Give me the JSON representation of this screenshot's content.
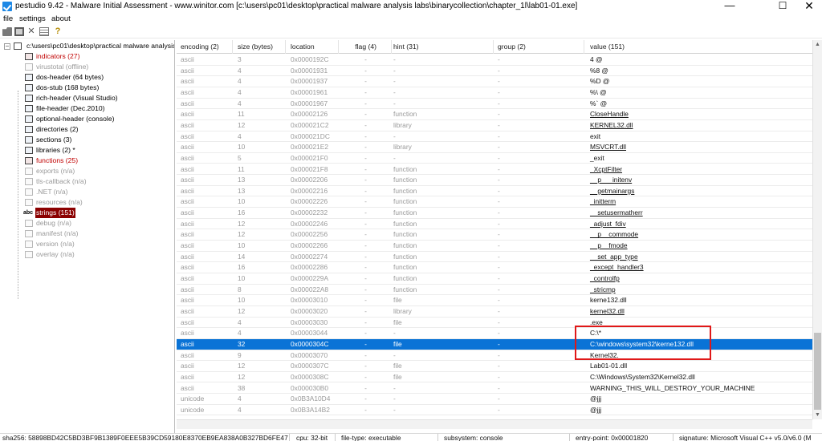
{
  "window": {
    "title": "pestudio 9.42 - Malware Initial Assessment - www.winitor.com [c:\\users\\pc01\\desktop\\practical malware analysis labs\\binarycollection\\chapter_1l\\lab01-01.exe]",
    "minimize": "—",
    "maximize": "☐",
    "close": "✕"
  },
  "menu": {
    "file": "file",
    "settings": "settings",
    "about": "about"
  },
  "tree": {
    "root": "c:\\users\\pc01\\desktop\\practical malware analysis",
    "items": [
      {
        "label": "indicators (27)",
        "color": "red",
        "icon": "indicators-icon"
      },
      {
        "label": "virustotal (offline)",
        "color": "gray",
        "icon": "virustotal-icon"
      },
      {
        "label": "dos-header (64 bytes)",
        "color": "black",
        "icon": "dos-header-icon"
      },
      {
        "label": "dos-stub (168 bytes)",
        "color": "black",
        "icon": "dos-stub-icon"
      },
      {
        "label": "rich-header (Visual Studio)",
        "color": "black",
        "icon": "rich-header-icon"
      },
      {
        "label": "file-header (Dec.2010)",
        "color": "black",
        "icon": "file-header-icon"
      },
      {
        "label": "optional-header (console)",
        "color": "black",
        "icon": "optional-header-icon"
      },
      {
        "label": "directories (2)",
        "color": "black",
        "icon": "directories-icon"
      },
      {
        "label": "sections (3)",
        "color": "black",
        "icon": "sections-icon"
      },
      {
        "label": "libraries (2) *",
        "color": "black",
        "icon": "libraries-icon"
      },
      {
        "label": "functions (25)",
        "color": "red",
        "icon": "functions-icon"
      },
      {
        "label": "exports (n/a)",
        "color": "gray",
        "icon": "exports-icon"
      },
      {
        "label": "tls-callback (n/a)",
        "color": "gray",
        "icon": "tls-callback-icon"
      },
      {
        "label": ".NET (n/a)",
        "color": "gray",
        "icon": "dotnet-icon"
      },
      {
        "label": "resources (n/a)",
        "color": "gray",
        "icon": "resources-icon"
      },
      {
        "label": "strings (151)",
        "color": "selected",
        "icon": "strings-icon",
        "icon_text": "abc"
      },
      {
        "label": "debug (n/a)",
        "color": "gray",
        "icon": "debug-icon"
      },
      {
        "label": "manifest (n/a)",
        "color": "gray",
        "icon": "manifest-icon"
      },
      {
        "label": "version (n/a)",
        "color": "gray",
        "icon": "version-icon"
      },
      {
        "label": "overlay (n/a)",
        "color": "gray",
        "icon": "overlay-icon"
      }
    ]
  },
  "columns": [
    "encoding (2)",
    "size (bytes)",
    "location",
    "flag (4)",
    "hint (31)",
    "group (2)",
    "value (151)"
  ],
  "rows": [
    [
      "ascii",
      "3",
      "0x0000192C",
      "-",
      "-",
      "-",
      "4 @",
      false
    ],
    [
      "ascii",
      "4",
      "0x00001931",
      "-",
      "-",
      "-",
      "%8 @",
      false
    ],
    [
      "ascii",
      "4",
      "0x00001937",
      "-",
      "-",
      "-",
      "%D @",
      false
    ],
    [
      "ascii",
      "4",
      "0x00001961",
      "-",
      "-",
      "-",
      "%\\ @",
      false
    ],
    [
      "ascii",
      "4",
      "0x00001967",
      "-",
      "-",
      "-",
      "%` @",
      false
    ],
    [
      "ascii",
      "11",
      "0x00002126",
      "-",
      "function",
      "-",
      "CloseHandle",
      true
    ],
    [
      "ascii",
      "12",
      "0x000021C2",
      "-",
      "library",
      "-",
      "KERNEL32.dll",
      true
    ],
    [
      "ascii",
      "4",
      "0x000021DC",
      "-",
      "-",
      "-",
      "exit",
      false
    ],
    [
      "ascii",
      "10",
      "0x000021E2",
      "-",
      "library",
      "-",
      "MSVCRT.dll",
      true
    ],
    [
      "ascii",
      "5",
      "0x000021F0",
      "-",
      "-",
      "-",
      "_exit",
      false
    ],
    [
      "ascii",
      "11",
      "0x000021F8",
      "-",
      "function",
      "-",
      "_XcptFilter",
      true
    ],
    [
      "ascii",
      "13",
      "0x00002206",
      "-",
      "function",
      "-",
      "__p___initenv",
      true
    ],
    [
      "ascii",
      "13",
      "0x00002216",
      "-",
      "function",
      "-",
      "__getmainargs",
      true
    ],
    [
      "ascii",
      "10",
      "0x00002226",
      "-",
      "function",
      "-",
      "_initterm",
      true
    ],
    [
      "ascii",
      "16",
      "0x00002232",
      "-",
      "function",
      "-",
      "__setusermatherr",
      true
    ],
    [
      "ascii",
      "12",
      "0x00002246",
      "-",
      "function",
      "-",
      "_adjust_fdiv",
      true
    ],
    [
      "ascii",
      "12",
      "0x00002256",
      "-",
      "function",
      "-",
      "__p__commode",
      true
    ],
    [
      "ascii",
      "10",
      "0x00002266",
      "-",
      "function",
      "-",
      "__p__fmode",
      true
    ],
    [
      "ascii",
      "14",
      "0x00002274",
      "-",
      "function",
      "-",
      "__set_app_type",
      true
    ],
    [
      "ascii",
      "16",
      "0x00002286",
      "-",
      "function",
      "-",
      "_except_handler3",
      true
    ],
    [
      "ascii",
      "10",
      "0x0000229A",
      "-",
      "function",
      "-",
      "_controlfp",
      true
    ],
    [
      "ascii",
      "8",
      "0x000022A8",
      "-",
      "function",
      "-",
      "_stricmp",
      true
    ],
    [
      "ascii",
      "10",
      "0x00003010",
      "-",
      "file",
      "-",
      "kerne132.dll",
      false
    ],
    [
      "ascii",
      "12",
      "0x00003020",
      "-",
      "library",
      "-",
      "kernel32.dll",
      true
    ],
    [
      "ascii",
      "4",
      "0x00003030",
      "-",
      "file",
      "-",
      ".exe",
      false
    ],
    [
      "ascii",
      "4",
      "0x00003044",
      "-",
      "-",
      "-",
      "C:\\*",
      false
    ],
    [
      "ascii",
      "32",
      "0x0000304C",
      "-",
      "file",
      "-",
      "C:\\windows\\system32\\kerne132.dll",
      false
    ],
    [
      "ascii",
      "9",
      "0x00003070",
      "-",
      "-",
      "-",
      "Kernel32.",
      false
    ],
    [
      "ascii",
      "12",
      "0x0000307C",
      "-",
      "file",
      "-",
      "Lab01-01.dll",
      false
    ],
    [
      "ascii",
      "12",
      "0x0000308C",
      "-",
      "file",
      "-",
      "C:\\Windows\\System32\\Kernel32.dll",
      false
    ],
    [
      "ascii",
      "38",
      "0x000030B0",
      "-",
      "-",
      "-",
      "WARNING_THIS_WILL_DESTROY_YOUR_MACHINE",
      false
    ],
    [
      "unicode",
      "4",
      "0x0B3A10D4",
      "-",
      "-",
      "-",
      "@jjj",
      false
    ],
    [
      "unicode",
      "4",
      "0x0B3A14B2",
      "-",
      "-",
      "-",
      "@jjj",
      false
    ]
  ],
  "selected_row": 26,
  "status": {
    "sha": "sha256: 58898BD42C5BD3BF9B1389F0EEE5B39CD59180E8370EB9EA838A0B327BD6FE47",
    "cpu": "cpu: 32-bit",
    "file_type": "file-type: executable",
    "subsystem": "subsystem: console",
    "entry_point": "entry-point: 0x00001820",
    "signature": "signature: Microsoft Visual C++ v5.0/v6.0 (M"
  },
  "colors": {
    "selection": "#0a73d6",
    "tree_selection": "#8b0000",
    "annotation": "#e01818",
    "alert_text": "#c00000"
  }
}
